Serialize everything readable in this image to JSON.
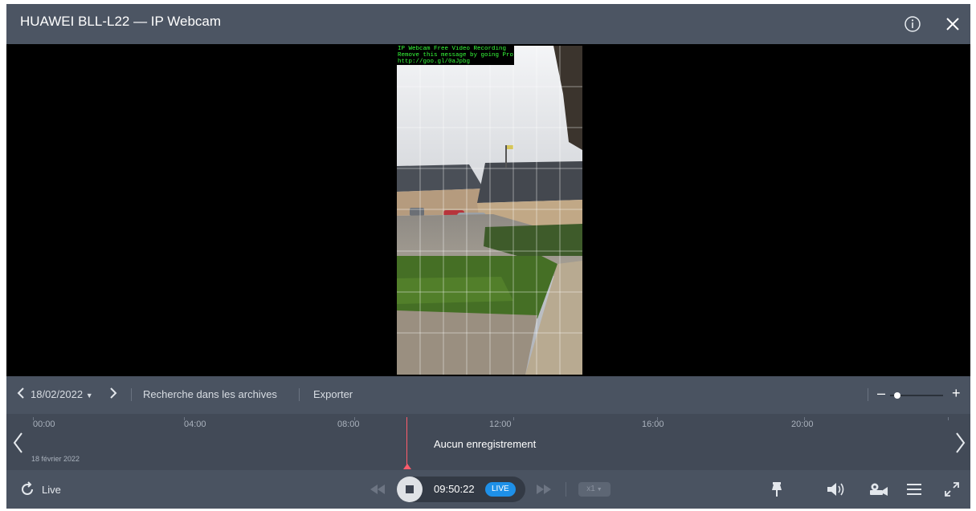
{
  "window": {
    "title": "HUAWEI BLL-L22 — IP Webcam",
    "info_icon": "info-icon",
    "close_icon": "close-icon"
  },
  "video": {
    "watermark_line1": "IP Webcam Free Video Recording",
    "watermark_line2": "Remove this message by going Pro",
    "watermark_line3": "http://goo.gl/0aJpbg"
  },
  "toolbar": {
    "date": "18/02/2022",
    "search_archives": "Recherche dans les archives",
    "export": "Exporter",
    "zoom_minus": "–",
    "zoom_plus": "+"
  },
  "timeline": {
    "ticks": [
      "00:00",
      "04:00",
      "08:00",
      "12:00",
      "16:00",
      "20:00"
    ],
    "date_label": "18 février 2022",
    "no_recording": "Aucun enregistrement"
  },
  "bottom": {
    "live_label": "Live",
    "time": "09:50:22",
    "live_badge": "LIVE",
    "speed": "x1"
  },
  "colors": {
    "accent": "#1e90e8",
    "cursor": "#ff5c6c",
    "window_bg": "#4a5361"
  }
}
